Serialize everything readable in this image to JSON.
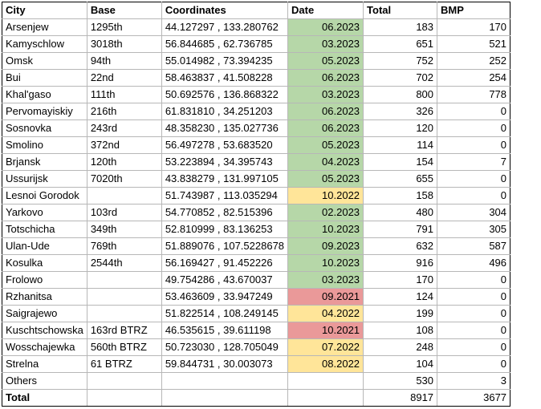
{
  "headers": [
    "City",
    "Base",
    "Coordinates",
    "Date",
    "Total",
    "BMP"
  ],
  "colors": {
    "green": "#b6d7a8",
    "yellow": "#ffe599",
    "red": "#ea9999",
    "grid": "#b7b7b7"
  },
  "rows": [
    {
      "city": "Arsenjew",
      "base": "1295th",
      "coords": "44.127297 , 133.280762",
      "date": "06.2023",
      "date_color": "green",
      "total": "183",
      "bmp": "170"
    },
    {
      "city": "Kamyschlow",
      "base": "3018th",
      "coords": "56.844685 , 62.736785",
      "date": "03.2023",
      "date_color": "green",
      "total": "651",
      "bmp": "521"
    },
    {
      "city": "Omsk",
      "base": "94th",
      "coords": "55.014982 , 73.394235",
      "date": "05.2023",
      "date_color": "green",
      "total": "752",
      "bmp": "252"
    },
    {
      "city": "Bui",
      "base": "22nd",
      "coords": "58.463837 , 41.508228",
      "date": "06.2023",
      "date_color": "green",
      "total": "702",
      "bmp": "254"
    },
    {
      "city": "Khal'gaso",
      "base": "111th",
      "coords": "50.692576 , 136.868322",
      "date": "03.2023",
      "date_color": "green",
      "total": "800",
      "bmp": "778"
    },
    {
      "city": "Pervomayiskiy",
      "base": "216th",
      "coords": "61.831810 , 34.251203",
      "date": "06.2023",
      "date_color": "green",
      "total": "326",
      "bmp": "0"
    },
    {
      "city": "Sosnovka",
      "base": "243rd",
      "coords": "48.358230 , 135.027736",
      "date": "06.2023",
      "date_color": "green",
      "total": "120",
      "bmp": "0"
    },
    {
      "city": "Smolino",
      "base": "372nd",
      "coords": "56.497278 , 53.683520",
      "date": "05.2023",
      "date_color": "green",
      "total": "114",
      "bmp": "0"
    },
    {
      "city": "Brjansk",
      "base": "120th",
      "coords": "53.223894 , 34.395743",
      "date": "04.2023",
      "date_color": "green",
      "total": "154",
      "bmp": "7"
    },
    {
      "city": "Ussurijsk",
      "base": "7020th",
      "coords": "43.838279 , 131.997105",
      "date": "05.2023",
      "date_color": "green",
      "total": "655",
      "bmp": "0"
    },
    {
      "city": "Lesnoi Gorodok",
      "base": "",
      "coords": "51.743987 , 113.035294",
      "date": "10.2022",
      "date_color": "yellow",
      "total": "158",
      "bmp": "0"
    },
    {
      "city": "Yarkovo",
      "base": "103rd",
      "coords": "54.770852 , 82.515396",
      "date": "02.2023",
      "date_color": "green",
      "total": "480",
      "bmp": "304"
    },
    {
      "city": "Totschicha",
      "base": "349th",
      "coords": "52.810999 , 83.136253",
      "date": "10.2023",
      "date_color": "green",
      "total": "791",
      "bmp": "305"
    },
    {
      "city": "Ulan-Ude",
      "base": "769th",
      "coords": "51.889076 , 107.5228678",
      "date": "09.2023",
      "date_color": "green",
      "total": "632",
      "bmp": "587"
    },
    {
      "city": "Kosulka",
      "base": "2544th",
      "coords": "56.169427 , 91.452226",
      "date": "10.2023",
      "date_color": "green",
      "total": "916",
      "bmp": "496"
    },
    {
      "city": "Frolowo",
      "base": "",
      "coords": "49.754286 , 43.670037",
      "date": "03.2023",
      "date_color": "green",
      "total": "170",
      "bmp": "0"
    },
    {
      "city": "Rzhanitsa",
      "base": "",
      "coords": "53.463609 , 33.947249",
      "date": "09.2021",
      "date_color": "red",
      "total": "124",
      "bmp": "0"
    },
    {
      "city": "Saigrajewo",
      "base": "",
      "coords": "51.822514 , 108.249145",
      "date": "04.2022",
      "date_color": "yellow",
      "total": "199",
      "bmp": "0"
    },
    {
      "city": "Kuschtschowska",
      "base": "163rd BTRZ",
      "coords": "46.535615 , 39.611198",
      "date": "10.2021",
      "date_color": "red",
      "total": "108",
      "bmp": "0"
    },
    {
      "city": "Wosschajewka",
      "base": "560th BTRZ",
      "coords": "50.723030 , 128.705049",
      "date": "07.2022",
      "date_color": "yellow",
      "total": "248",
      "bmp": "0"
    },
    {
      "city": "Strelna",
      "base": "61 BTRZ",
      "coords": "59.844731 , 30.003073",
      "date": "08.2022",
      "date_color": "yellow",
      "total": "104",
      "bmp": "0"
    },
    {
      "city": "Others",
      "base": "",
      "coords": "",
      "date": "",
      "date_color": "",
      "total": "530",
      "bmp": "3"
    }
  ],
  "total_row": {
    "label": "Total",
    "total": "8917",
    "bmp": "3677"
  }
}
